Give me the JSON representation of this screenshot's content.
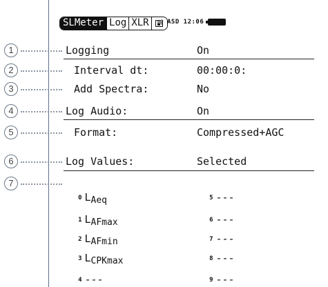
{
  "header": {
    "tabs": [
      "SLMeter",
      "Log",
      "XLR"
    ],
    "save_icon": "save-icon",
    "status_text": "ASD 12:06"
  },
  "rows": [
    {
      "callout": "1",
      "label": "Logging",
      "value": "On"
    },
    {
      "callout": "2",
      "label": "Interval dt:",
      "value": "00:00:0:"
    },
    {
      "callout": "3",
      "label": "Add Spectra:",
      "value": "No"
    },
    {
      "callout": "4",
      "label": "Log Audio:",
      "value": "On"
    },
    {
      "callout": "5",
      "label": "Format:",
      "value": "Compressed+AGC"
    },
    {
      "callout": "6",
      "label": "Log Values:",
      "value": "Selected"
    }
  ],
  "callout7": "7",
  "values_left": [
    {
      "index": "0",
      "main": "L",
      "sub": "Aeq"
    },
    {
      "index": "1",
      "main": "L",
      "sub": "AFmax"
    },
    {
      "index": "2",
      "main": "L",
      "sub": "AFmin"
    },
    {
      "index": "3",
      "main": "L",
      "sub": "CPKmax"
    },
    {
      "index": "4",
      "main": "---",
      "sub": ""
    }
  ],
  "values_right": [
    {
      "index": "5",
      "main": "---"
    },
    {
      "index": "6",
      "main": "---"
    },
    {
      "index": "7",
      "main": "---"
    },
    {
      "index": "8",
      "main": "---"
    },
    {
      "index": "9",
      "main": "---"
    }
  ]
}
